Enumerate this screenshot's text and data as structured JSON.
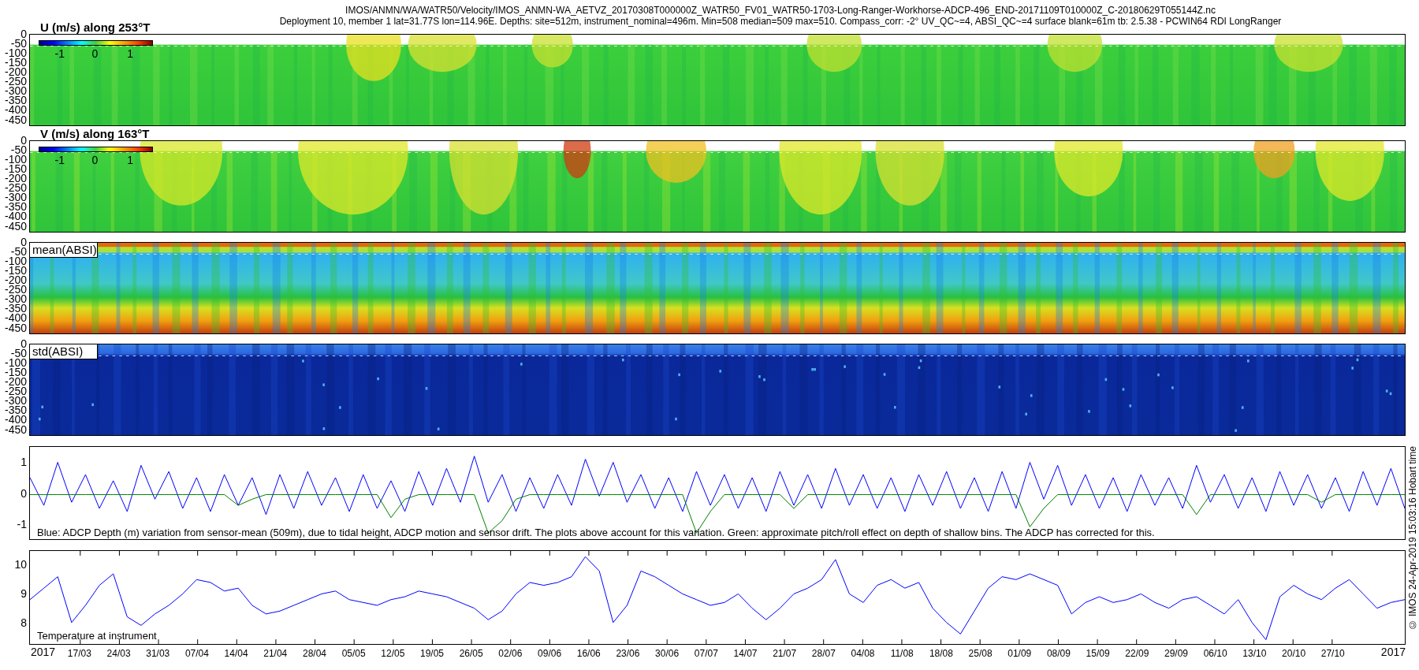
{
  "title_lines": [
    "IMOS/ANMN/WA/WATR50/Velocity/IMOS_ANMN-WA_AETVZ_20170308T000000Z_WATR50_FV01_WATR50-1703-Long-Ranger-Workhorse-ADCP-496_END-20171109T010000Z_C-20180629T055144Z.nc",
    "Deployment 10, member 1 lat=31.77S lon=114.96E. Depths: site=512m, instrument_nominal=496m. Min=508 median=509 max=510. Compass_corr: -2° UV_QC~=4, ABSI_QC~=4 surface blank=61m tb: 2.5.38 - PCWIN64 RDI LongRanger"
  ],
  "heatmaps": [
    {
      "label": "U (m/s) along 253°T",
      "kind": "velocity_u",
      "colorbar_ticks": [
        "-1",
        "0",
        "1"
      ],
      "yticks": [
        "0",
        "-50",
        "-100",
        "-150",
        "-200",
        "-250",
        "-300",
        "-350",
        "-400",
        "-450"
      ]
    },
    {
      "label": "V (m/s) along 163°T",
      "kind": "velocity_v",
      "colorbar_ticks": [
        "-1",
        "0",
        "1"
      ],
      "yticks": [
        "0",
        "-50",
        "-100",
        "-150",
        "-200",
        "-250",
        "-300",
        "-350",
        "-400",
        "-450"
      ]
    },
    {
      "label": "mean(ABSI)",
      "kind": "mean",
      "yticks": [
        "0",
        "-50",
        "-100",
        "-150",
        "-200",
        "-250",
        "-300",
        "-350",
        "-400",
        "-450"
      ]
    },
    {
      "label": "std(ABSI)",
      "kind": "std",
      "yticks": [
        "0",
        "-50",
        "-100",
        "-150",
        "-200",
        "-250",
        "-300",
        "-350",
        "-400",
        "-450"
      ]
    }
  ],
  "depth_variation": {
    "caption": "Blue: ADCP Depth (m) variation from sensor-mean (509m), due to tidal height, ADCP motion and sensor drift. The plots above account for this variation. Green: approximate pitch/roll effect on depth of shallow bins. The ADCP has corrected for this.",
    "chart_data": {
      "type": "line",
      "ylim": [
        -1.5,
        1.5
      ],
      "yticks": [
        1,
        0,
        -1
      ],
      "series": [
        {
          "color": "#0000ff",
          "values": [
            0.5,
            -0.4,
            1.0,
            -0.3,
            0.6,
            -0.5,
            0.4,
            -0.6,
            0.9,
            -0.2,
            0.7,
            -0.5,
            0.5,
            -0.6,
            0.6,
            -0.4,
            0.5,
            -0.7,
            0.6,
            -0.5,
            0.7,
            -0.4,
            0.5,
            -0.6,
            0.6,
            -0.5,
            0.4,
            -0.6,
            0.7,
            -0.4,
            0.8,
            -0.3,
            1.2,
            -0.3,
            0.6,
            -0.6,
            0.5,
            -0.5,
            0.6,
            -0.4,
            1.1,
            -0.1,
            1.0,
            -0.3,
            0.6,
            -0.5,
            0.5,
            -0.6,
            0.7,
            -0.4,
            0.6,
            -0.5,
            0.5,
            -0.6,
            0.7,
            -0.4,
            0.6,
            -0.5,
            0.8,
            -0.4,
            0.6,
            -0.5,
            0.5,
            -0.6,
            0.6,
            -0.4,
            0.7,
            -0.5,
            0.5,
            -0.6,
            0.7,
            -0.5,
            1.0,
            -0.2,
            0.9,
            -0.4,
            0.6,
            -0.5,
            0.5,
            -0.6,
            0.6,
            -0.4,
            0.5,
            -0.5,
            0.9,
            -0.3,
            0.6,
            -0.5,
            0.5,
            -0.6,
            0.7,
            -0.4,
            0.6,
            -0.5,
            0.5,
            -0.6,
            0.7,
            -0.4,
            0.8,
            -0.5
          ]
        },
        {
          "color": "#008000",
          "values": [
            -0.05,
            -0.05,
            -0.05,
            -0.05,
            -0.05,
            -0.05,
            -0.05,
            -0.05,
            -0.05,
            -0.05,
            -0.05,
            -0.05,
            -0.05,
            -0.05,
            -0.05,
            -0.4,
            -0.2,
            -0.05,
            -0.05,
            -0.05,
            -0.05,
            -0.05,
            -0.05,
            -0.05,
            -0.05,
            -0.05,
            -0.8,
            -0.2,
            -0.05,
            -0.05,
            -0.05,
            -0.05,
            -0.05,
            -1.3,
            -0.9,
            -0.2,
            -0.05,
            -0.05,
            -0.05,
            -0.05,
            -0.05,
            -0.05,
            -0.05,
            -0.05,
            -0.05,
            -0.05,
            -0.05,
            -0.05,
            -1.3,
            -0.6,
            -0.05,
            -0.05,
            -0.05,
            -0.05,
            -0.05,
            -0.5,
            -0.05,
            -0.05,
            -0.05,
            -0.05,
            -0.05,
            -0.05,
            -0.05,
            -0.05,
            -0.05,
            -0.05,
            -0.05,
            -0.05,
            -0.05,
            -0.05,
            -0.05,
            -0.05,
            -1.1,
            -0.5,
            -0.05,
            -0.05,
            -0.05,
            -0.05,
            -0.05,
            -0.05,
            -0.05,
            -0.05,
            -0.05,
            -0.05,
            -0.7,
            -0.05,
            -0.05,
            -0.05,
            -0.05,
            -0.05,
            -0.05,
            -0.05,
            -0.05,
            -0.3,
            -0.05,
            -0.05,
            -0.05,
            -0.05,
            -0.05,
            -0.05
          ]
        }
      ]
    }
  },
  "temperature": {
    "caption": "Temperature at instrument",
    "chart_data": {
      "type": "line",
      "ylim": [
        7.25,
        10.5
      ],
      "yticks": [
        10,
        9,
        8
      ],
      "series": [
        {
          "color": "#0000ff",
          "values": [
            8.8,
            9.2,
            9.6,
            8.0,
            8.6,
            9.3,
            9.7,
            8.2,
            7.9,
            8.3,
            8.6,
            9.0,
            9.5,
            9.4,
            9.1,
            9.2,
            8.6,
            8.3,
            8.4,
            8.6,
            8.8,
            9.0,
            9.1,
            8.8,
            8.7,
            8.6,
            8.8,
            8.9,
            9.1,
            9.0,
            8.9,
            8.7,
            8.5,
            8.1,
            8.4,
            9.0,
            9.4,
            9.3,
            9.4,
            9.6,
            10.3,
            9.8,
            8.0,
            8.6,
            9.8,
            9.6,
            9.3,
            9.0,
            8.8,
            8.6,
            8.7,
            9.0,
            8.5,
            8.1,
            8.5,
            9.0,
            9.2,
            9.5,
            10.2,
            9.0,
            8.7,
            9.3,
            9.5,
            9.2,
            9.4,
            8.5,
            8.0,
            7.6,
            8.4,
            9.2,
            9.6,
            9.5,
            9.7,
            9.5,
            9.3,
            8.3,
            8.7,
            8.9,
            8.7,
            8.8,
            9.0,
            8.7,
            8.5,
            8.8,
            8.9,
            8.6,
            8.3,
            8.8,
            8.0,
            7.4,
            8.9,
            9.3,
            9.0,
            8.8,
            9.2,
            9.5,
            9.0,
            8.5,
            8.7,
            8.8
          ]
        }
      ]
    }
  },
  "x_axis": {
    "start_label": "2017",
    "end_label": "2017",
    "ticks": [
      "17/03",
      "24/03",
      "31/03",
      "07/04",
      "14/04",
      "21/04",
      "28/04",
      "05/05",
      "12/05",
      "19/05",
      "26/05",
      "02/06",
      "09/06",
      "16/06",
      "23/06",
      "30/06",
      "07/07",
      "14/07",
      "21/07",
      "28/07",
      "04/08",
      "11/08",
      "18/08",
      "25/08",
      "01/09",
      "08/09",
      "15/09",
      "22/09",
      "29/09",
      "06/10",
      "13/10",
      "20/10",
      "27/10"
    ]
  },
  "footer": "© IMOS 24-Apr-2019 15:03:16 Hobart time"
}
